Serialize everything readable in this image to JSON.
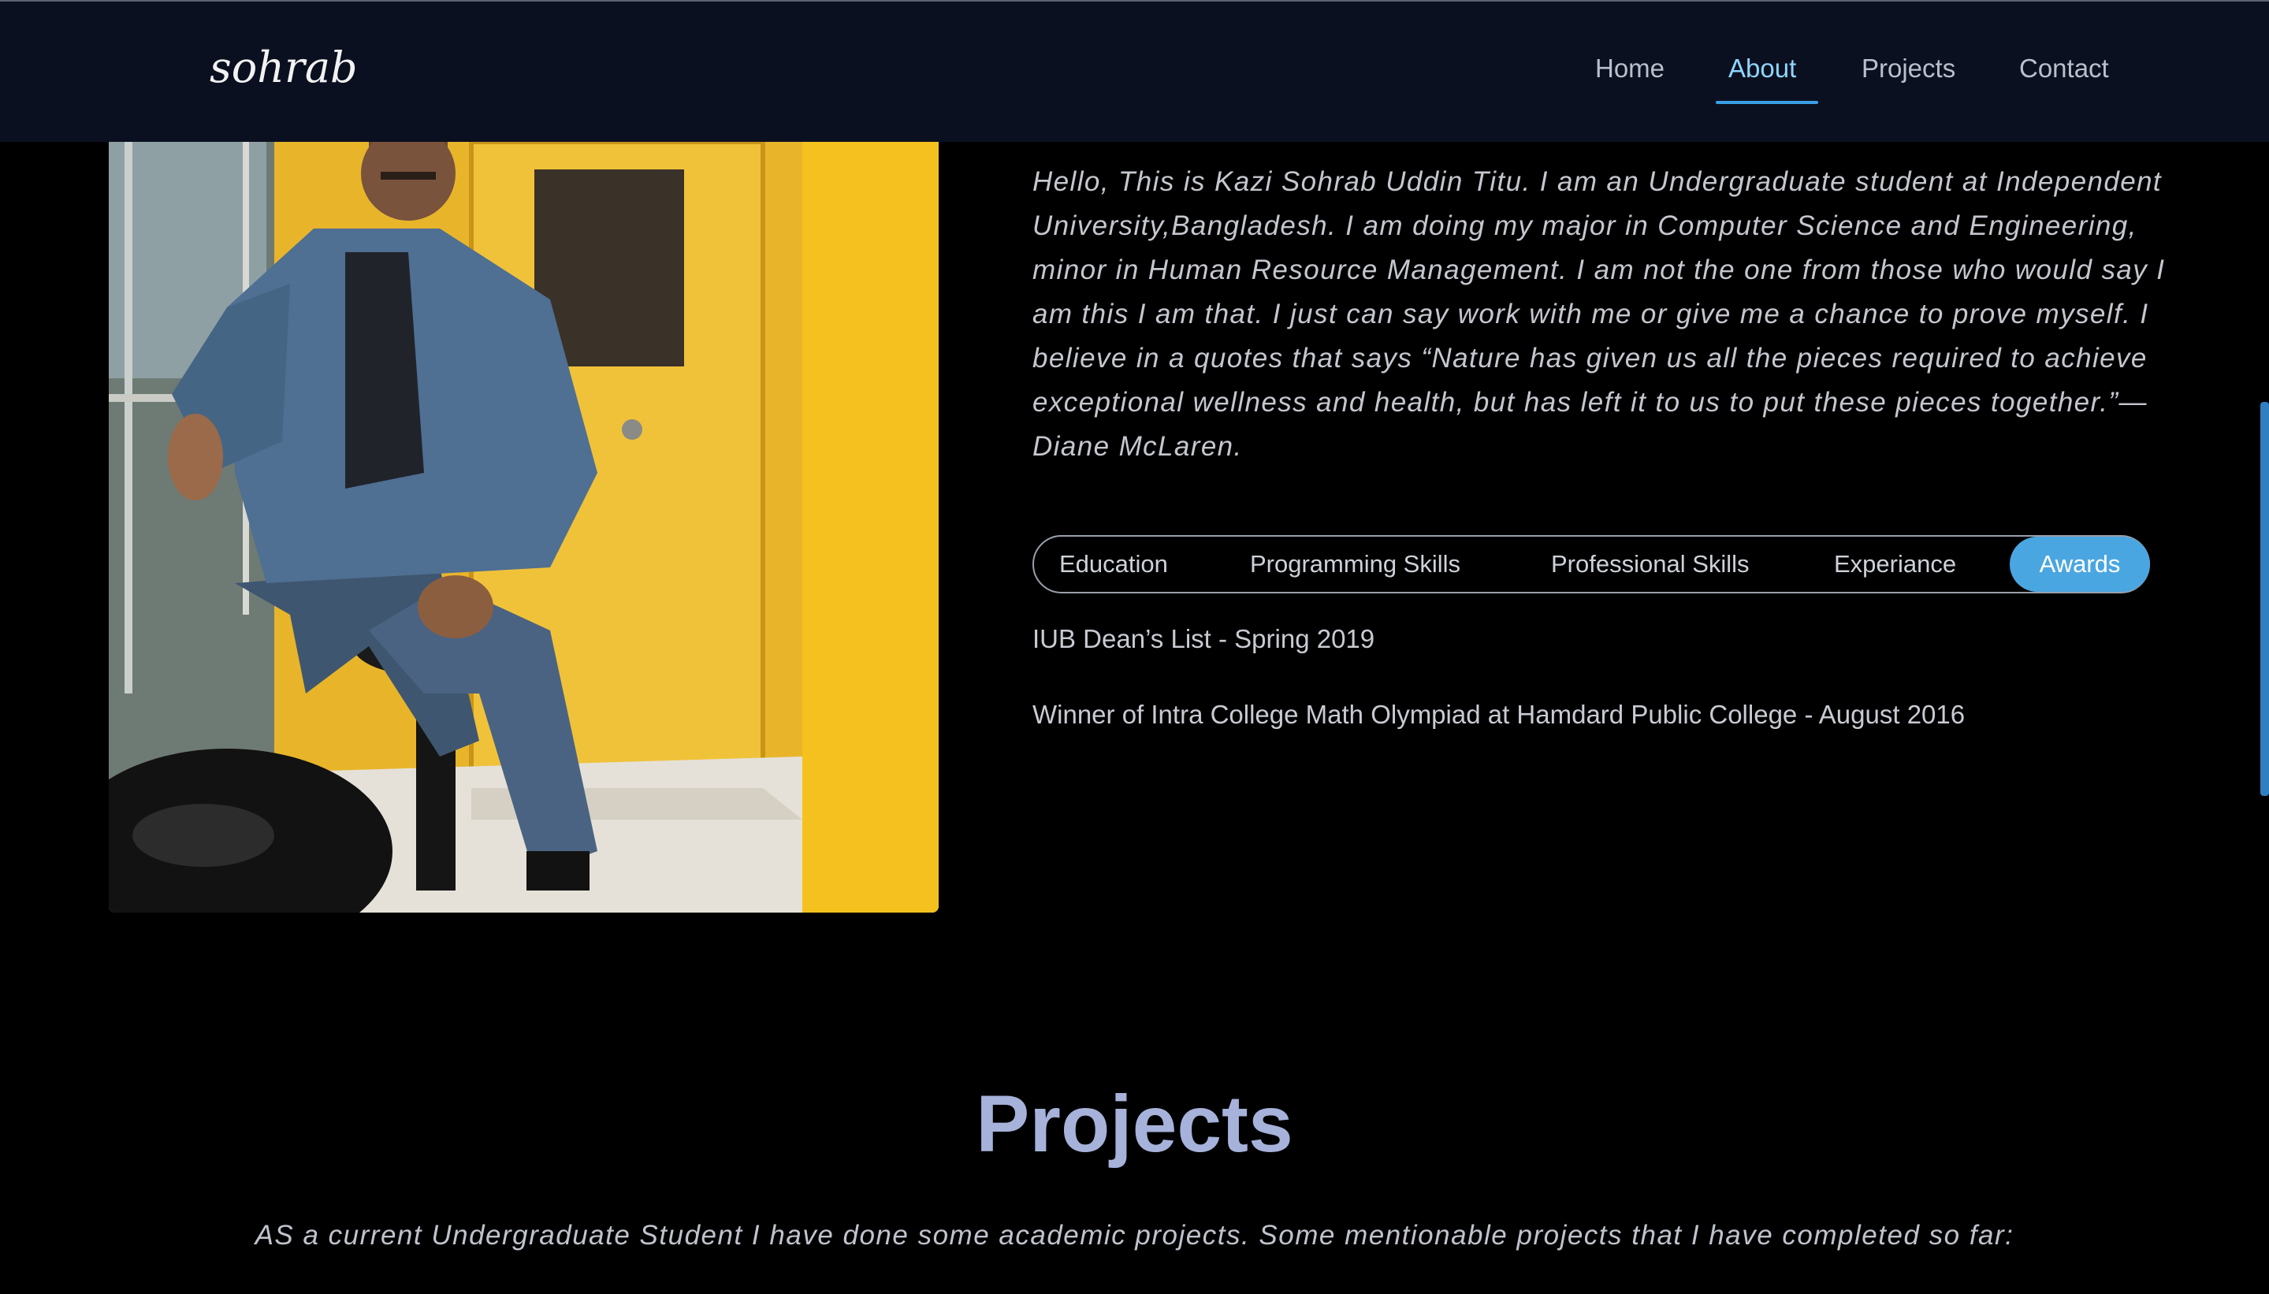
{
  "nav": {
    "logo": "sohrab",
    "items": [
      {
        "label": "Home",
        "active": false
      },
      {
        "label": "About",
        "active": true
      },
      {
        "label": "Projects",
        "active": false
      },
      {
        "label": "Contact",
        "active": false
      }
    ]
  },
  "about": {
    "bio": "Hello, This is Kazi Sohrab Uddin Titu. I am an Undergraduate student at Independent University,Bangladesh. I am doing my major in Computer Science and Engineering, minor in Human Resource Management. I am not the one from those who would say I am this I am that. I just can say work with me or give me a chance to prove myself. I believe in a quotes that says “Nature has given us all the pieces required to achieve exceptional wellness and health, but has left it to us to put these pieces together.”—Diane McLaren.",
    "tabs": [
      {
        "label": "Education",
        "active": false
      },
      {
        "label": "Programming Skills",
        "active": false
      },
      {
        "label": "Professional Skills",
        "active": false
      },
      {
        "label": "Experiance",
        "active": false
      },
      {
        "label": "Awards",
        "active": true
      }
    ],
    "awards": [
      "IUB Dean’s List - Spring 2019",
      "Winner of Intra College Math Olympiad at Hamdard Public College - August 2016"
    ]
  },
  "projects": {
    "title": "Projects",
    "subtitle": "AS a current Undergraduate Student I have done some academic projects. Some mentionable projects that I have completed so far:"
  },
  "colors": {
    "navbar_bg": "#0b1020",
    "accent": "#4aa6e0",
    "active_nav": "#8fd6ff",
    "projects_title": "#a6b2da"
  }
}
